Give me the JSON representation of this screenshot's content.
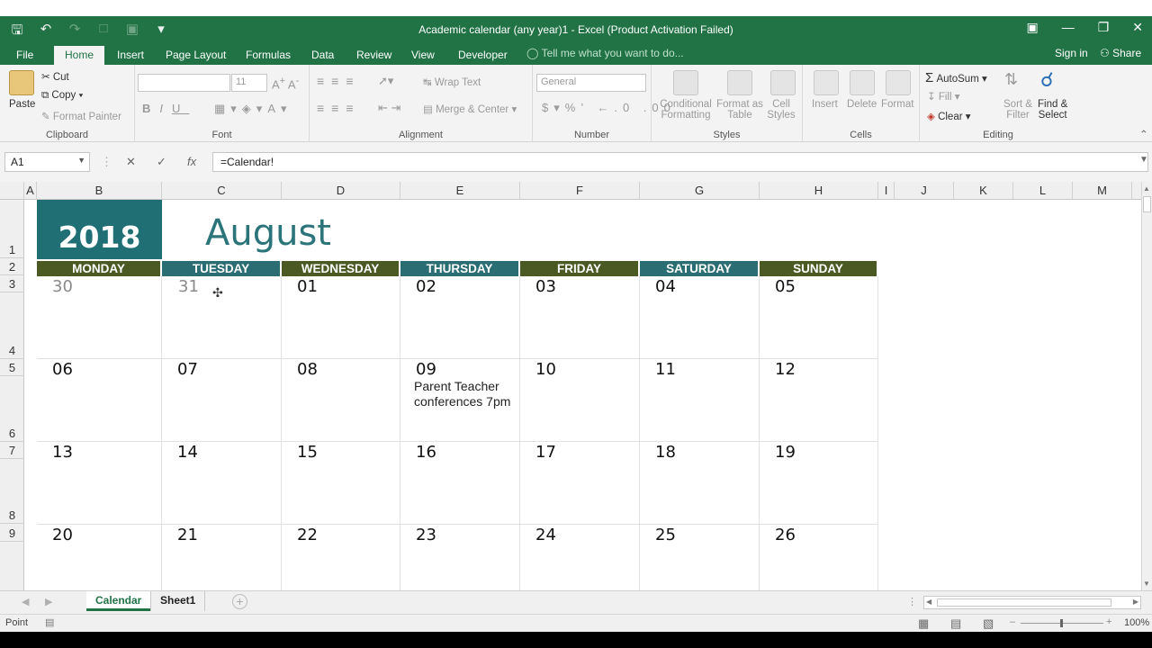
{
  "window": {
    "title": "Academic calendar (any year)1 - Excel (Product Activation Failed)"
  },
  "tabs": [
    "File",
    "Home",
    "Insert",
    "Page Layout",
    "Formulas",
    "Data",
    "Review",
    "View",
    "Developer"
  ],
  "tellme": "Tell me what you want to do...",
  "account": {
    "signin": "Sign in",
    "share": "Share"
  },
  "ribbon": {
    "clipboard": {
      "label": "Clipboard",
      "paste": "Paste",
      "cut": "Cut",
      "copy": "Copy",
      "format_painter": "Format Painter"
    },
    "font": {
      "label": "Font",
      "size": "11"
    },
    "alignment": {
      "label": "Alignment",
      "wrap_text": "Wrap Text",
      "merge_center": "Merge & Center"
    },
    "number": {
      "label": "Number",
      "format": "General"
    },
    "styles": {
      "label": "Styles",
      "conditional_1": "Conditional",
      "conditional_2": "Formatting",
      "format_as_1": "Format as",
      "format_as_2": "Table",
      "cell_1": "Cell",
      "cell_2": "Styles"
    },
    "cells": {
      "label": "Cells",
      "insert": "Insert",
      "delete": "Delete",
      "format": "Format"
    },
    "editing": {
      "label": "Editing",
      "autosum": "AutoSum",
      "fill": "Fill",
      "clear": "Clear",
      "sort_1": "Sort &",
      "sort_2": "Filter",
      "find_1": "Find &",
      "find_2": "Select"
    }
  },
  "formula_bar": {
    "name_box": "A1",
    "formula": "=Calendar!"
  },
  "columns": [
    "A",
    "B",
    "C",
    "D",
    "E",
    "F",
    "G",
    "H",
    "I",
    "J",
    "K",
    "L",
    "M"
  ],
  "rows": [
    "1",
    "2",
    "3",
    "4",
    "5",
    "6",
    "7",
    "8",
    "9"
  ],
  "calendar": {
    "year": "2018",
    "month": "August",
    "days": [
      "MONDAY",
      "TUESDAY",
      "WEDNESDAY",
      "THURSDAY",
      "FRIDAY",
      "SATURDAY",
      "SUNDAY"
    ],
    "weeks": [
      [
        "30",
        "31",
        "01",
        "02",
        "03",
        "04",
        "05"
      ],
      [
        "06",
        "07",
        "08",
        "09",
        "10",
        "11",
        "12"
      ],
      [
        "13",
        "14",
        "15",
        "16",
        "17",
        "18",
        "19"
      ],
      [
        "20",
        "21",
        "22",
        "23",
        "24",
        "25",
        "26"
      ]
    ],
    "event": "Parent Teacher conferences 7pm",
    "colors": {
      "year_bg": "#1f6f74",
      "head_olive": "#4a5a22",
      "head_teal": "#2a6d73",
      "title": "#2b7479"
    }
  },
  "sheets": [
    "Calendar",
    "Sheet1"
  ],
  "status": {
    "mode": "Point",
    "zoom": "100%"
  }
}
